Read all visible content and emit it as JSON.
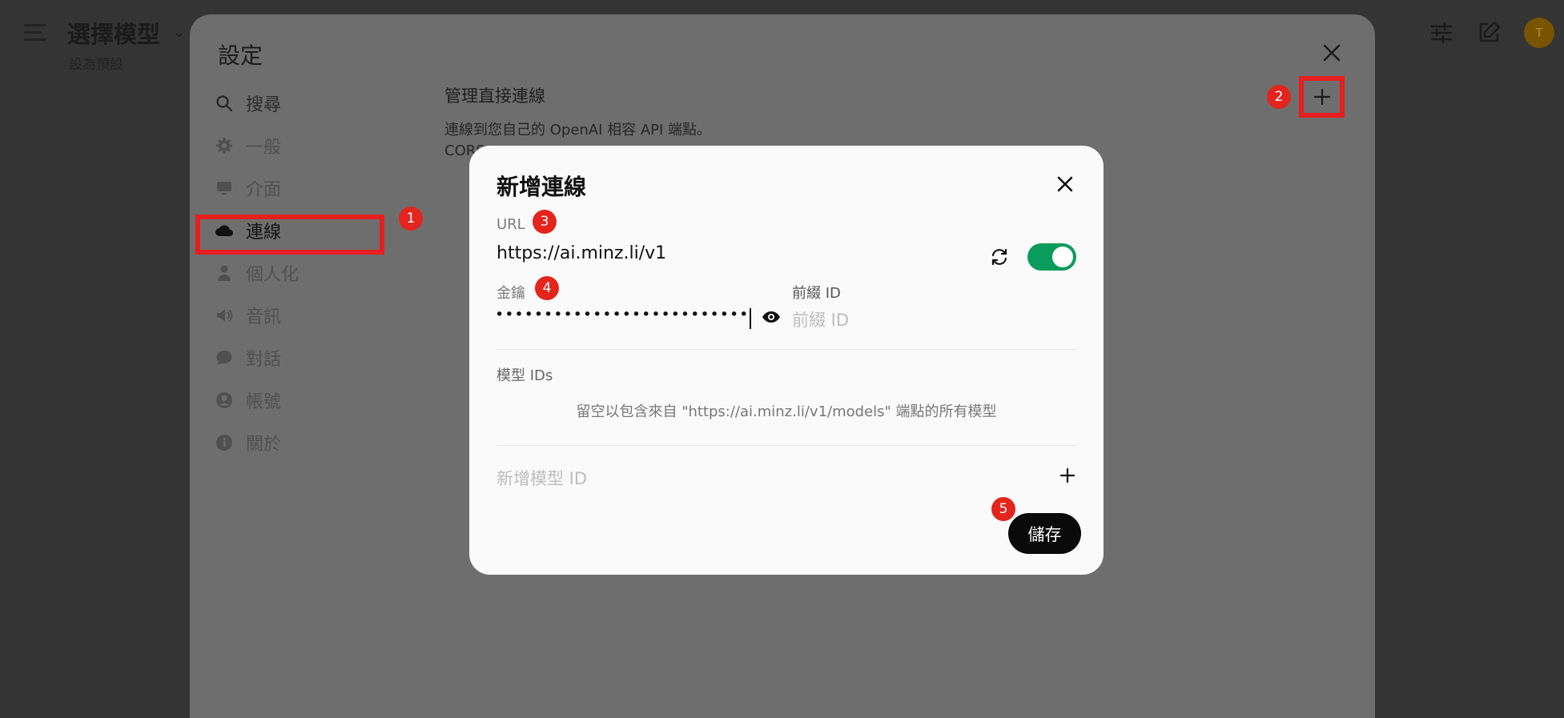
{
  "app": {
    "title": "選擇模型",
    "subtitle": "設為預設"
  },
  "settings": {
    "title": "設定",
    "nav": [
      {
        "label": "搜尋",
        "icon": "search-icon"
      },
      {
        "label": "一般",
        "icon": "gear-icon"
      },
      {
        "label": "介面",
        "icon": "monitor-icon"
      },
      {
        "label": "連線",
        "icon": "cloud-icon"
      },
      {
        "label": "個人化",
        "icon": "person-icon"
      },
      {
        "label": "音訊",
        "icon": "speaker-icon"
      },
      {
        "label": "對話",
        "icon": "chat-icon"
      },
      {
        "label": "帳號",
        "icon": "user-circle-icon"
      },
      {
        "label": "關於",
        "icon": "info-icon"
      }
    ],
    "section_title": "管理直接連線",
    "section_desc_1": "連線到您自己的 OpenAI 相容 API 端點。",
    "section_desc_2": "CORS"
  },
  "dialog": {
    "title": "新增連線",
    "url_label": "URL",
    "url_value": "https://ai.minz.li/v1",
    "key_label": "金鑰",
    "key_value": "••••••••••••••••••••••••••",
    "prefix_label": "前綴 ID",
    "prefix_placeholder": "前綴 ID",
    "model_ids_label": "模型 IDs",
    "model_ids_hint": "留空以包含來自 \"https://ai.minz.li/v1/models\" 端點的所有模型",
    "add_model_placeholder": "新增模型 ID",
    "save_label": "儲存",
    "toggle_on": true
  },
  "markers": [
    "1",
    "2",
    "3",
    "4",
    "5"
  ],
  "colors": {
    "accent_green": "#0a9c5c",
    "marker_red": "#e3251d",
    "highlight_red": "#e51f1f"
  }
}
